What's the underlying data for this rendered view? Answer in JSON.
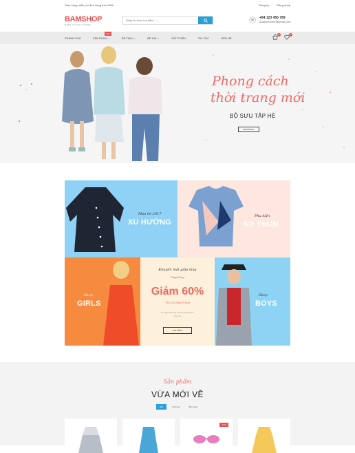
{
  "topbar": {
    "notice": "Giao hàng miễn phí đơn hàng trên 500k",
    "register": "Đăng ký",
    "login": "Đăng nhập"
  },
  "header": {
    "logo": "BAMSHOP",
    "tagline": "BABY CLOTH STORE",
    "search_placeholder": "Nhập từ khóa tìm kiếm ......",
    "phone": "+84 123 456 789",
    "email": "duabenhome@gmail.com"
  },
  "nav": {
    "items": [
      "TRANG CHỦ",
      "SẢN PHẨM",
      "BÉ TRAI",
      "BÉ GÁI",
      "GIỚI THIỆU",
      "TIN TỨC",
      "LIÊN HỆ"
    ],
    "hot_badge": "HOT",
    "cart_count": "0",
    "wish_count": "0"
  },
  "hero": {
    "line1": "Phong cách",
    "line2": "thời trang mới",
    "subtitle": "BỘ SƯU TẬP HÈ",
    "button": "MUA NGAY"
  },
  "banners": {
    "b1": {
      "small": "Mùa hè 2017",
      "big": "XU HƯỚNG"
    },
    "b2": {
      "small": "Phụ kiện",
      "big": "ÁO THUN"
    },
    "b3": {
      "small": "Shop",
      "big": "GIRLS"
    },
    "b4": {
      "small": "Khuyến mãi giữa mùa",
      "big": "Giảm 60%",
      "sub": "TẤT CẢ SẢN PHẨM",
      "desc1": "Từ ngày đến hết mùa hè 2018 dành",
      "desc2": "cho con",
      "button": "CHI TIẾT"
    },
    "b5": {
      "small": "Shop",
      "big": "BOYS"
    }
  },
  "products": {
    "small": "Sản phẩm",
    "big": "VỪA MỚI VỀ",
    "tabs": [
      "Mới",
      "Giới hạn",
      "Bán chạy"
    ],
    "sale_badge": "-15%"
  },
  "colors": {
    "accent": "#f04e4e",
    "blue": "#2aa0d9",
    "coral": "#ef6a63"
  }
}
